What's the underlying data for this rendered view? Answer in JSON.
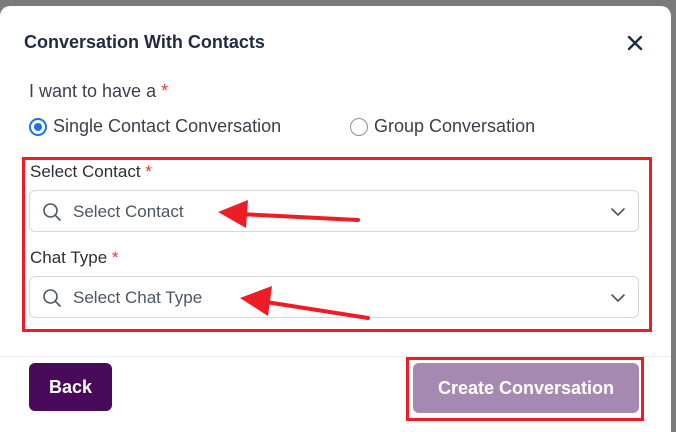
{
  "dialog": {
    "title": "Conversation With Contacts",
    "question": "I want to have a",
    "required_mark": "*",
    "options": [
      {
        "label": "Single Contact Conversation",
        "checked": true
      },
      {
        "label": "Group Conversation",
        "checked": false
      }
    ]
  },
  "fields": {
    "contact": {
      "label": "Select Contact",
      "placeholder": "Select Contact"
    },
    "chat_type": {
      "label": "Chat Type",
      "placeholder": "Select Chat Type"
    }
  },
  "footer": {
    "back_label": "Back",
    "create_label": "Create Conversation"
  },
  "colors": {
    "accent": "#1a73e8",
    "back_button": "#4a0a5c",
    "create_button": "#a689b0",
    "annotation": "#ee1c25",
    "required": "#e53935"
  },
  "icons": [
    "close-icon",
    "search-icon",
    "chevron-down-icon"
  ]
}
